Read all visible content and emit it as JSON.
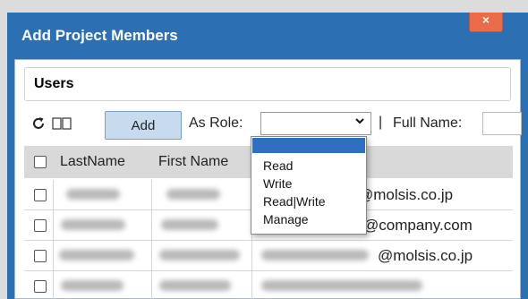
{
  "dialog": {
    "title": "Add Project Members",
    "close_label": "×"
  },
  "panel": {
    "section_title": "Users"
  },
  "toolbar": {
    "refresh_icon": "refresh-icon",
    "columns_icon": "columns-icon",
    "add_label": "Add",
    "role_label": "As Role:",
    "role_value": "",
    "separator": "|",
    "fullname_label": "Full Name:",
    "fullname_value": ""
  },
  "role_dropdown": {
    "options": [
      "",
      "Read",
      "Write",
      "Read|Write",
      "Manage"
    ],
    "highlighted": ""
  },
  "grid": {
    "columns": [
      "LastName",
      "First Name"
    ],
    "rows": [
      {
        "email": "@molsis.co.jp"
      },
      {
        "email": "@company.com"
      },
      {
        "email": "@molsis.co.jp"
      }
    ]
  },
  "colors": {
    "titlebar": "#2c6fb3",
    "close_button": "#e96b4a",
    "add_button": "#c8dbee",
    "dropdown_highlight": "#2f6fc0"
  }
}
